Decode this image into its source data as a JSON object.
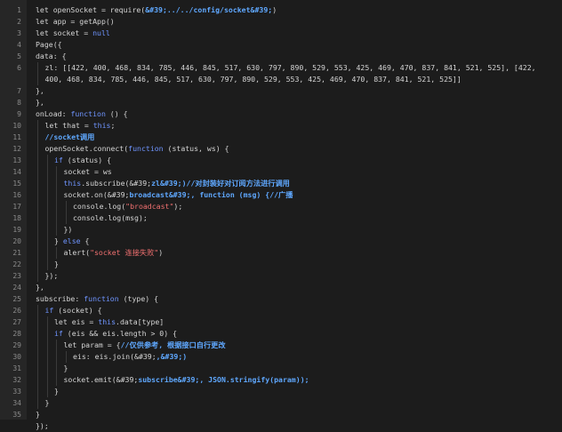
{
  "editor": {
    "lines": [
      {
        "n": "1",
        "indent": 0,
        "segs": [
          [
            "n",
            "let openSocket = require("
          ],
          [
            "c",
            "&#39;../../config/socket&#39;"
          ],
          [
            "n",
            ")"
          ]
        ]
      },
      {
        "n": "2",
        "indent": 0,
        "segs": [
          [
            "n",
            "let app = getApp()"
          ]
        ]
      },
      {
        "n": "3",
        "indent": 0,
        "segs": [
          [
            "n",
            "let socket = "
          ],
          [
            "k",
            "null"
          ]
        ]
      },
      {
        "n": "4",
        "indent": 0,
        "segs": [
          [
            "n",
            "Page({"
          ]
        ]
      },
      {
        "n": "5",
        "indent": 0,
        "segs": [
          [
            "n",
            "data: {"
          ]
        ]
      },
      {
        "n": "6",
        "indent": 1,
        "wrap": true,
        "segs": [
          [
            "n",
            "zl: [[422, 400, 468, 834, 785, 446, 845, 517, 630, 797, 890, 529, 553, 425, 469, 470, 837, 841, 521, 525], [422, 400, 468, 834, 785, 446, 845, 517, 630, 797, 890, 529, 553, 425, 469, 470, 837, 841, 521, 525]]"
          ]
        ]
      },
      {
        "n": "7",
        "indent": 0,
        "segs": [
          [
            "n",
            "},"
          ]
        ]
      },
      {
        "n": "8",
        "indent": 0,
        "segs": [
          [
            "n",
            "},"
          ]
        ]
      },
      {
        "n": "9",
        "indent": 0,
        "segs": [
          [
            "n",
            "onLoad: "
          ],
          [
            "k",
            "function"
          ],
          [
            "n",
            " () {"
          ]
        ]
      },
      {
        "n": "10",
        "indent": 1,
        "segs": [
          [
            "n",
            "let that = "
          ],
          [
            "k",
            "this"
          ],
          [
            "n",
            ";"
          ]
        ]
      },
      {
        "n": "11",
        "indent": 1,
        "segs": [
          [
            "c",
            "//socket调用"
          ]
        ]
      },
      {
        "n": "12",
        "indent": 1,
        "segs": [
          [
            "n",
            "openSocket.connect("
          ],
          [
            "k",
            "function"
          ],
          [
            "n",
            " (status, ws) {"
          ]
        ]
      },
      {
        "n": "13",
        "indent": 2,
        "segs": [
          [
            "k",
            "if"
          ],
          [
            "n",
            " (status) {"
          ]
        ]
      },
      {
        "n": "14",
        "indent": 3,
        "segs": [
          [
            "n",
            "socket = ws"
          ]
        ]
      },
      {
        "n": "15",
        "indent": 3,
        "segs": [
          [
            "k",
            "this"
          ],
          [
            "n",
            ".subscribe(&#39;"
          ],
          [
            "c",
            "zl&#39;)//对封装好对订阅方法进行调用"
          ]
        ]
      },
      {
        "n": "16",
        "indent": 3,
        "segs": [
          [
            "n",
            "socket.on(&#39;"
          ],
          [
            "c",
            "broadcast&#39;, function (msg) {//广播"
          ]
        ]
      },
      {
        "n": "17",
        "indent": 4,
        "segs": [
          [
            "n",
            "console.log("
          ],
          [
            "s",
            "\"broadcast\""
          ],
          [
            "n",
            ");"
          ]
        ]
      },
      {
        "n": "18",
        "indent": 4,
        "segs": [
          [
            "n",
            "console.log(msg);"
          ]
        ]
      },
      {
        "n": "19",
        "indent": 3,
        "segs": [
          [
            "n",
            "})"
          ]
        ]
      },
      {
        "n": "20",
        "indent": 2,
        "segs": [
          [
            "n",
            "} "
          ],
          [
            "k",
            "else"
          ],
          [
            "n",
            " {"
          ]
        ]
      },
      {
        "n": "21",
        "indent": 3,
        "segs": [
          [
            "n",
            "alert("
          ],
          [
            "s",
            "\"socket 连接失败\""
          ],
          [
            "n",
            ")"
          ]
        ]
      },
      {
        "n": "22",
        "indent": 2,
        "segs": [
          [
            "n",
            "}"
          ]
        ]
      },
      {
        "n": "23",
        "indent": 1,
        "segs": [
          [
            "n",
            "});"
          ]
        ]
      },
      {
        "n": "24",
        "indent": 0,
        "segs": [
          [
            "n",
            "},"
          ]
        ]
      },
      {
        "n": "25",
        "indent": 0,
        "segs": [
          [
            "n",
            "subscribe: "
          ],
          [
            "k",
            "function"
          ],
          [
            "n",
            " (type) {"
          ]
        ]
      },
      {
        "n": "26",
        "indent": 1,
        "segs": [
          [
            "k",
            "if"
          ],
          [
            "n",
            " (socket) {"
          ]
        ]
      },
      {
        "n": "27",
        "indent": 2,
        "segs": [
          [
            "n",
            "let eis = "
          ],
          [
            "k",
            "this"
          ],
          [
            "n",
            ".data[type]"
          ]
        ]
      },
      {
        "n": "28",
        "indent": 2,
        "segs": [
          [
            "k",
            "if"
          ],
          [
            "n",
            " (eis && eis.length > 0) {"
          ]
        ]
      },
      {
        "n": "29",
        "indent": 3,
        "segs": [
          [
            "n",
            "let param = {"
          ],
          [
            "c",
            "//仅供参考, 根据接口自行更改"
          ]
        ]
      },
      {
        "n": "30",
        "indent": 4,
        "segs": [
          [
            "n",
            "eis: eis.join(&#39;"
          ],
          [
            "c",
            ",&#39;)"
          ]
        ]
      },
      {
        "n": "31",
        "indent": 3,
        "segs": [
          [
            "n",
            "}"
          ]
        ]
      },
      {
        "n": "32",
        "indent": 3,
        "segs": [
          [
            "n",
            "socket.emit(&#39;"
          ],
          [
            "c",
            "subscribe&#39;, JSON.stringify(param));"
          ]
        ]
      },
      {
        "n": "33",
        "indent": 2,
        "segs": [
          [
            "n",
            "}"
          ]
        ]
      },
      {
        "n": "34",
        "indent": 1,
        "segs": [
          [
            "n",
            "}"
          ]
        ]
      },
      {
        "n": "35",
        "indent": 0,
        "segs": [
          [
            "n",
            "}"
          ]
        ]
      },
      {
        "n": "",
        "indent": 0,
        "segs": [
          [
            "n",
            "});"
          ]
        ]
      }
    ]
  }
}
